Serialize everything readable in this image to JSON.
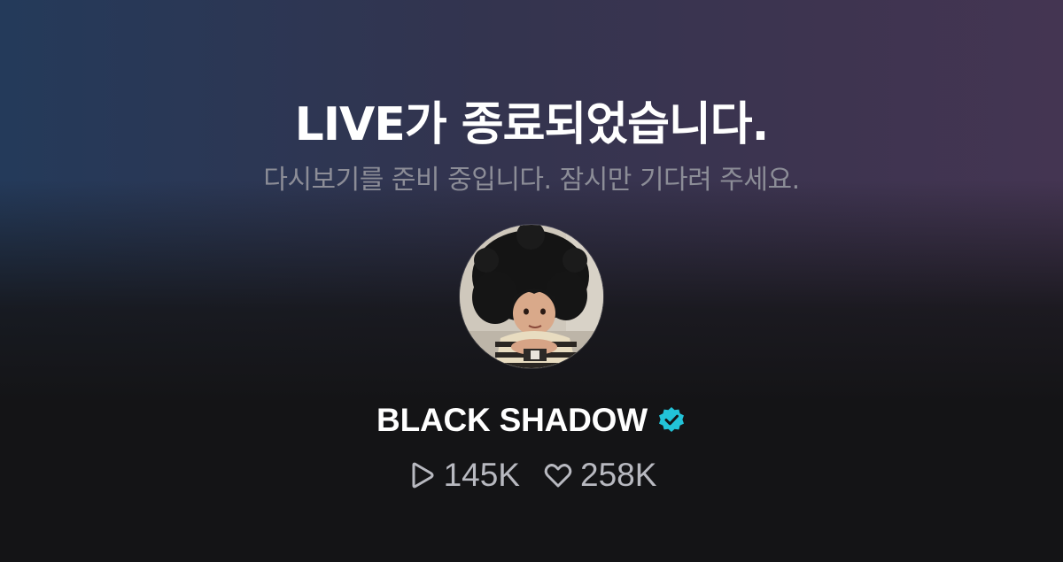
{
  "end_screen": {
    "title": "LIVE가 종료되었습니다.",
    "subtitle": "다시보기를 준비 중입니다. 잠시만 기다려 주세요."
  },
  "channel": {
    "name": "BLACK SHADOW",
    "verified": true,
    "verified_icon": "verified-badge-icon",
    "verified_color": "#22c3d8"
  },
  "stats": {
    "views": {
      "icon": "play-icon",
      "value": "145K"
    },
    "likes": {
      "icon": "heart-icon",
      "value": "258K"
    }
  }
}
